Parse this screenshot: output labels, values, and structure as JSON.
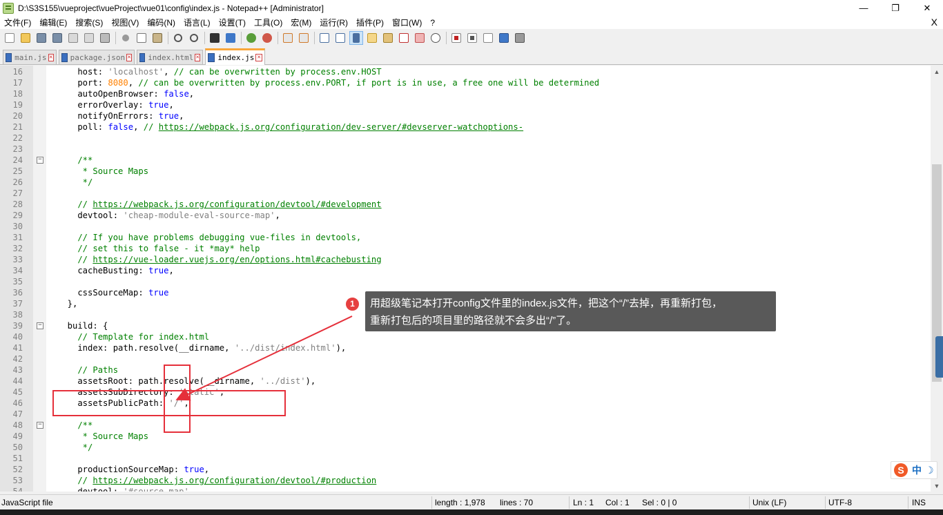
{
  "window": {
    "title": "D:\\S3S155\\vueproject\\vueProject\\vue01\\config\\index.js - Notepad++ [Administrator]",
    "minimize": "—",
    "restore": "❐",
    "close": "✕"
  },
  "menu": {
    "items": [
      "文件(F)",
      "编辑(E)",
      "搜索(S)",
      "视图(V)",
      "编码(N)",
      "语言(L)",
      "设置(T)",
      "工具(O)",
      "宏(M)",
      "运行(R)",
      "插件(P)",
      "窗口(W)",
      "?"
    ],
    "close": "X"
  },
  "tabs": [
    {
      "label": "main.js",
      "active": false
    },
    {
      "label": "package.json",
      "active": false
    },
    {
      "label": "index.html",
      "active": false
    },
    {
      "label": "index.js",
      "active": true
    }
  ],
  "editor": {
    "lines": [
      {
        "n": "16",
        "fold": "",
        "parts": [
          [
            "k",
            "    host: "
          ],
          [
            "s",
            "'localhost'"
          ],
          [
            "k",
            ", "
          ],
          [
            "c",
            "// can be overwritten by process.env.HOST"
          ]
        ]
      },
      {
        "n": "17",
        "fold": "",
        "parts": [
          [
            "k",
            "    port: "
          ],
          [
            "n",
            "8080"
          ],
          [
            "k",
            ", "
          ],
          [
            "c",
            "// can be overwritten by process.env.PORT, if port is in use, a free one will be determined"
          ]
        ]
      },
      {
        "n": "18",
        "fold": "",
        "parts": [
          [
            "k",
            "    autoOpenBrowser: "
          ],
          [
            "b",
            "false"
          ],
          [
            "k",
            ","
          ]
        ]
      },
      {
        "n": "19",
        "fold": "",
        "parts": [
          [
            "k",
            "    errorOverlay: "
          ],
          [
            "b",
            "true"
          ],
          [
            "k",
            ","
          ]
        ]
      },
      {
        "n": "20",
        "fold": "",
        "parts": [
          [
            "k",
            "    notifyOnErrors: "
          ],
          [
            "b",
            "true"
          ],
          [
            "k",
            ","
          ]
        ]
      },
      {
        "n": "21",
        "fold": "",
        "parts": [
          [
            "k",
            "    poll: "
          ],
          [
            "b",
            "false"
          ],
          [
            "k",
            ", "
          ],
          [
            "c",
            "// "
          ],
          [
            "u",
            "https://webpack.js.org/configuration/dev-server/#devserver-watchoptions-"
          ]
        ]
      },
      {
        "n": "22",
        "fold": "",
        "parts": []
      },
      {
        "n": "23",
        "fold": "",
        "parts": []
      },
      {
        "n": "24",
        "fold": "−",
        "parts": [
          [
            "c",
            "    /**"
          ]
        ]
      },
      {
        "n": "25",
        "fold": "",
        "parts": [
          [
            "c",
            "     * Source Maps"
          ]
        ]
      },
      {
        "n": "26",
        "fold": "",
        "parts": [
          [
            "c",
            "     */"
          ]
        ]
      },
      {
        "n": "27",
        "fold": "",
        "parts": []
      },
      {
        "n": "28",
        "fold": "",
        "parts": [
          [
            "c",
            "    // "
          ],
          [
            "u",
            "https://webpack.js.org/configuration/devtool/#development"
          ]
        ]
      },
      {
        "n": "29",
        "fold": "",
        "parts": [
          [
            "k",
            "    devtool: "
          ],
          [
            "s",
            "'cheap-module-eval-source-map'"
          ],
          [
            "k",
            ","
          ]
        ]
      },
      {
        "n": "30",
        "fold": "",
        "parts": []
      },
      {
        "n": "31",
        "fold": "",
        "parts": [
          [
            "c",
            "    // If you have problems debugging vue-files in devtools,"
          ]
        ]
      },
      {
        "n": "32",
        "fold": "",
        "parts": [
          [
            "c",
            "    // set this to false - it *may* help"
          ]
        ]
      },
      {
        "n": "33",
        "fold": "",
        "parts": [
          [
            "c",
            "    // "
          ],
          [
            "u",
            "https://vue-loader.vuejs.org/en/options.html#cachebusting"
          ]
        ]
      },
      {
        "n": "34",
        "fold": "",
        "parts": [
          [
            "k",
            "    cacheBusting: "
          ],
          [
            "b",
            "true"
          ],
          [
            "k",
            ","
          ]
        ]
      },
      {
        "n": "35",
        "fold": "",
        "parts": []
      },
      {
        "n": "36",
        "fold": "",
        "parts": [
          [
            "k",
            "    cssSourceMap: "
          ],
          [
            "b",
            "true"
          ]
        ]
      },
      {
        "n": "37",
        "fold": "",
        "parts": [
          [
            "k",
            "  },"
          ]
        ]
      },
      {
        "n": "38",
        "fold": "",
        "parts": []
      },
      {
        "n": "39",
        "fold": "−",
        "parts": [
          [
            "k",
            "  build: {"
          ]
        ]
      },
      {
        "n": "40",
        "fold": "",
        "parts": [
          [
            "c",
            "    // Template for index.html"
          ]
        ]
      },
      {
        "n": "41",
        "fold": "",
        "parts": [
          [
            "k",
            "    index: path.resolve(__dirname, "
          ],
          [
            "s",
            "'../dist/index.html'"
          ],
          [
            "k",
            "),"
          ]
        ]
      },
      {
        "n": "42",
        "fold": "",
        "parts": []
      },
      {
        "n": "43",
        "fold": "",
        "parts": [
          [
            "c",
            "    // Paths"
          ]
        ]
      },
      {
        "n": "44",
        "fold": "",
        "parts": [
          [
            "k",
            "    assetsRoot: path.resolve(__dirname, "
          ],
          [
            "s",
            "'../dist'"
          ],
          [
            "k",
            "),"
          ]
        ]
      },
      {
        "n": "45",
        "fold": "",
        "parts": [
          [
            "k",
            "    assetsSubDirectory: "
          ],
          [
            "s",
            "'static'"
          ],
          [
            "k",
            ","
          ]
        ]
      },
      {
        "n": "46",
        "fold": "",
        "parts": [
          [
            "k",
            "    assetsPublicPath: "
          ],
          [
            "s",
            "'/'"
          ],
          [
            "k",
            ","
          ]
        ]
      },
      {
        "n": "47",
        "fold": "",
        "parts": []
      },
      {
        "n": "48",
        "fold": "−",
        "parts": [
          [
            "c",
            "    /**"
          ]
        ]
      },
      {
        "n": "49",
        "fold": "",
        "parts": [
          [
            "c",
            "     * Source Maps"
          ]
        ]
      },
      {
        "n": "50",
        "fold": "",
        "parts": [
          [
            "c",
            "     */"
          ]
        ]
      },
      {
        "n": "51",
        "fold": "",
        "parts": []
      },
      {
        "n": "52",
        "fold": "",
        "parts": [
          [
            "k",
            "    productionSourceMap: "
          ],
          [
            "b",
            "true"
          ],
          [
            "k",
            ","
          ]
        ]
      },
      {
        "n": "53",
        "fold": "",
        "parts": [
          [
            "c",
            "    // "
          ],
          [
            "u",
            "https://webpack.js.org/configuration/devtool/#production"
          ]
        ]
      },
      {
        "n": "54",
        "fold": "",
        "parts": [
          [
            "k",
            "    devtool: "
          ],
          [
            "s",
            "'#source-map'"
          ],
          [
            "k",
            ","
          ]
        ]
      }
    ]
  },
  "annotation": {
    "badge": "1",
    "line1": "用超级笔记本打开config文件里的index.js文件，把这个“/”去掉，再重新打包，",
    "line2": "重新打包后的项目里的路径就不会多出“/”了。"
  },
  "status": {
    "file_type": "JavaScript file",
    "length": "length : 1,978",
    "lines": "lines : 70",
    "ln": "Ln : 1",
    "col": "Col : 1",
    "sel": "Sel : 0 | 0",
    "eol": "Unix (LF)",
    "encoding": "UTF-8",
    "mode": "INS"
  },
  "ime": {
    "logo": "S",
    "lang": "中",
    "mode": "☽"
  },
  "colors": {
    "comment": "#008000",
    "string": "#808080",
    "number": "#ff8000",
    "keyword": "#0000ff",
    "highlight": "#e52f3a",
    "callout_bg": "#595959"
  }
}
